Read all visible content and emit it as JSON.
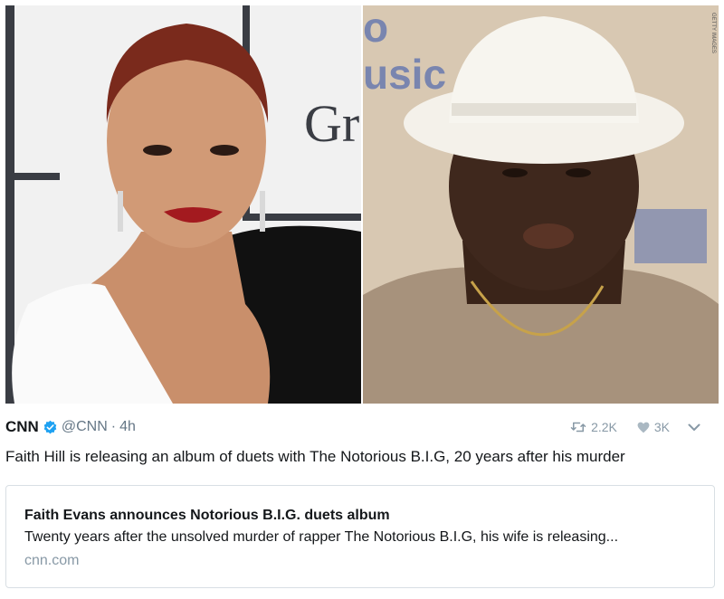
{
  "tweet": {
    "author_name": "CNN",
    "handle": "@CNN",
    "separator": "·",
    "time": "4h",
    "retweets": "2.2K",
    "likes": "3K",
    "text": "Faith Hill is releasing an album of duets with The Notorious B.I.G, 20 years after his murder"
  },
  "media": {
    "left_photo": {
      "backdrop_text": "Gr"
    },
    "right_photo": {
      "credit": "GETTY IMAGES",
      "backdrop_text": "usic"
    }
  },
  "link_card": {
    "title": "Faith Evans announces Notorious B.I.G. duets album",
    "description": "Twenty years after the unsolved murder of rapper The Notorious B.I.G, his wife is releasing...",
    "domain": "cnn.com"
  },
  "icons": {
    "verified": "verified-badge-icon",
    "retweet": "retweet-icon",
    "like": "heart-icon",
    "more": "chevron-down-icon"
  },
  "colors": {
    "verified_blue": "#1da1f2",
    "muted_gray": "#657786",
    "action_gray": "#8899a6",
    "border": "#d8dfe4"
  }
}
